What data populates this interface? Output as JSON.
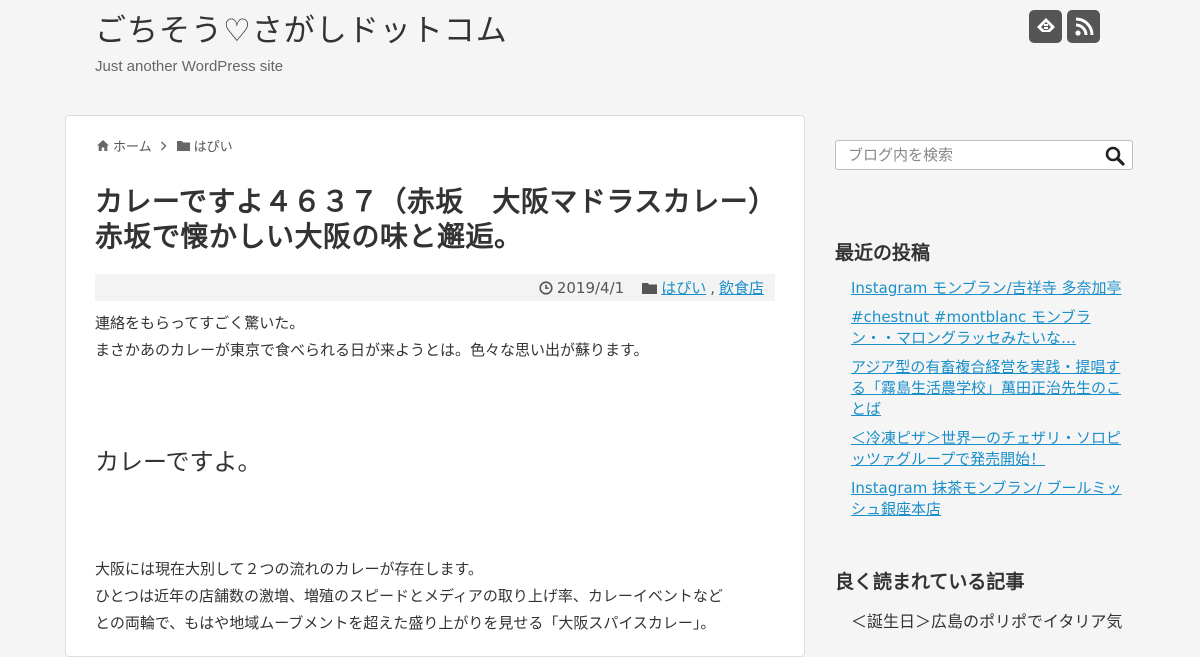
{
  "header": {
    "site_title": "ごちそう♡さがしドットコム",
    "tagline": "Just another WordPress site",
    "icons": [
      "feedly-icon",
      "rss-icon"
    ]
  },
  "breadcrumb": {
    "home": "ホーム",
    "category": "はぴい"
  },
  "post": {
    "title": "カレーですよ４６３７（赤坂　大阪マドラスカレー）赤坂で懐かしい大阪の味と邂逅。",
    "date": "2019/4/1",
    "categories": [
      "はぴい",
      "飲食店"
    ],
    "category_separator": ",",
    "body": {
      "line1": "連絡をもらってすごく驚いた。",
      "line2": "まさかあのカレーが東京で食べられる日が来ようとは。色々な思い出が蘇ります。",
      "heading": "カレーですよ。",
      "line3": "大阪には現在大別して２つの流れのカレーが存在します。",
      "line4": "ひとつは近年の店舗数の激増、増殖のスピードとメディアの取り上げ率、カレーイベントなど",
      "line5": "との両輪で、もはや地域ムーブメントを超えた盛り上がりを見せる「大阪スパイスカレー」。"
    }
  },
  "sidebar": {
    "search_placeholder": "ブログ内を検索",
    "recent_title": "最近の投稿",
    "recent_posts": [
      "Instagram モンブラン/吉祥寺 多奈加亭",
      "#chestnut #montblanc モンブラン・・マロングラッセみたいな…",
      "アジア型の有畜複合経営を実践・提唱する「霧島生活農学校」萬田正治先生のことば",
      "＜冷凍ピザ＞世界一のチェザリ・ソロピッツァグループで発売開始！",
      "Instagram 抹茶モンブラン/ ブールミッシュ銀座本店"
    ],
    "popular_title": "良く読まれている記事",
    "popular_first": "＜誕生日＞広島のポリポでイタリア気"
  },
  "colors": {
    "background": "#f5f5f5",
    "link": "#1a8fc9",
    "icon_bg": "#555555"
  }
}
